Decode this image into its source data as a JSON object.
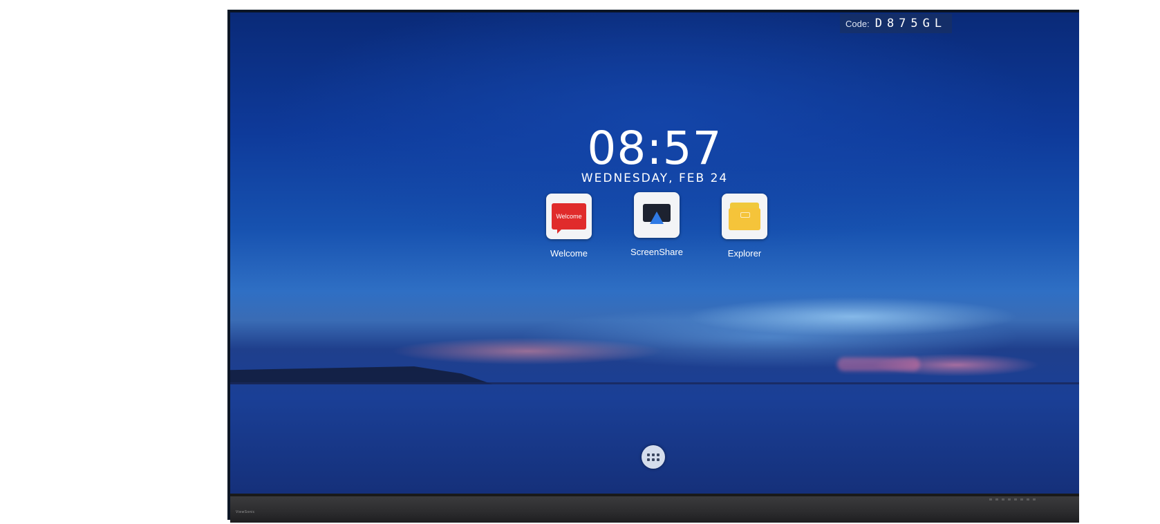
{
  "status": {
    "code_label": "Code:",
    "code_value": "D875GL"
  },
  "clock": {
    "time": "08:57",
    "date": "WEDNESDAY, FEB 24"
  },
  "apps": [
    {
      "label": "Welcome",
      "icon": "welcome-icon",
      "badge_text": "Welcome",
      "color": "#e02b2b"
    },
    {
      "label": "ScreenShare",
      "icon": "screenshare-icon",
      "color": "#2f7ae5"
    },
    {
      "label": "Explorer",
      "icon": "folder-icon",
      "color": "#f5c43a"
    }
  ],
  "dock": {
    "icon": "app-drawer-icon"
  },
  "bezel": {
    "brand": "ViewSonic"
  }
}
